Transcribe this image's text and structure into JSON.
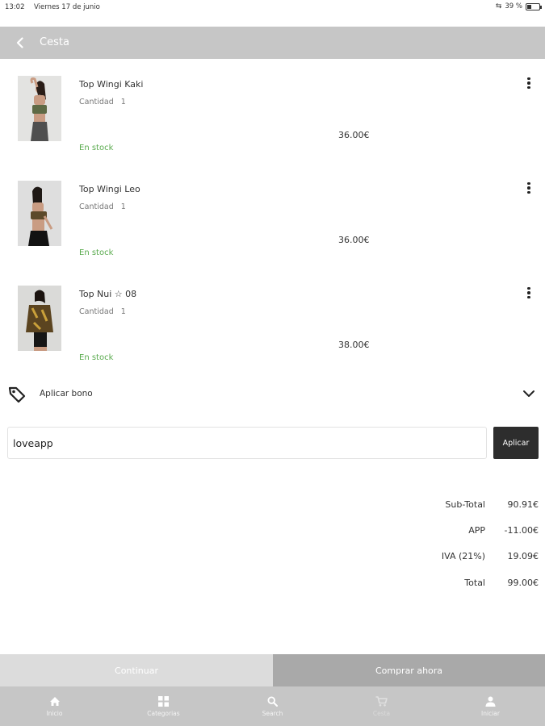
{
  "status_bar": {
    "time": "13:02",
    "date": "Viernes 17 de junio",
    "battery": "39 %",
    "battery_level": 0.39
  },
  "header": {
    "title": "Cesta",
    "back_icon": "chevron-left-icon"
  },
  "cart": {
    "items": [
      {
        "name": "Top Wingi Kaki",
        "quantity_label": "Cantidad",
        "quantity": "1",
        "price": "36.00€",
        "stock": "En stock",
        "menu_icon": "more-vertical-icon"
      },
      {
        "name": "Top Wingi Leo",
        "quantity_label": "Cantidad",
        "quantity": "1",
        "price": "36.00€",
        "stock": "En stock",
        "menu_icon": "more-vertical-icon"
      },
      {
        "name": "Top Nui ☆ 08",
        "quantity_label": "Cantidad",
        "quantity": "1",
        "price": "38.00€",
        "stock": "En stock",
        "menu_icon": "more-vertical-icon"
      }
    ]
  },
  "voucher": {
    "label": "Aplicar bono",
    "tag_icon": "tag-icon",
    "chevron_icon": "chevron-down-icon",
    "input_value": "loveapp",
    "apply_label": "Aplicar"
  },
  "summary": {
    "rows": [
      {
        "label": "Sub-Total",
        "value": "90.91€"
      },
      {
        "label": "APP",
        "value": "-11.00€"
      },
      {
        "label": "IVA (21%)",
        "value": "19.09€"
      },
      {
        "label": "Total",
        "value": "99.00€"
      }
    ]
  },
  "actions": {
    "continue_label": "Continuar",
    "buy_label": "Comprar ahora"
  },
  "bottom_nav": {
    "items": [
      {
        "label": "Inicio",
        "icon": "home-icon"
      },
      {
        "label": "Categorias",
        "icon": "grid-icon"
      },
      {
        "label": "Search",
        "icon": "search-icon"
      },
      {
        "label": "Cesta",
        "icon": "cart-icon"
      },
      {
        "label": "Iniciar",
        "icon": "user-icon"
      }
    ]
  },
  "colors": {
    "header_bg": "#c6c6c6",
    "stock_green": "#5aab4e",
    "apply_button": "#2d2d2d",
    "continue_bg": "#dcdcdc",
    "buy_bg": "#a9a9a9"
  }
}
